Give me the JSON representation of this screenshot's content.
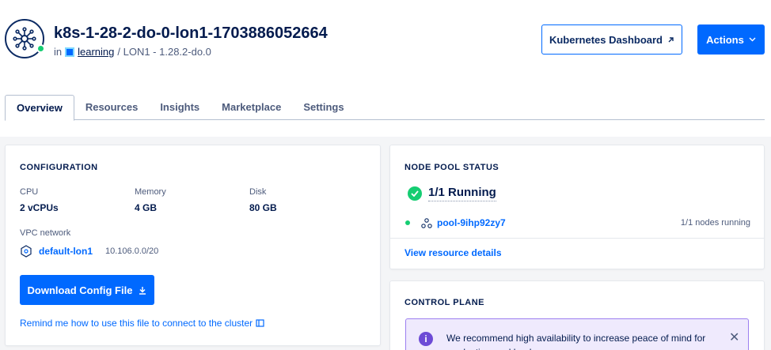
{
  "header": {
    "title": "k8s-1-28-2-do-0-lon1-1703886052664",
    "in_label": "in",
    "project_link": "learning",
    "location": "/ LON1 - 1.28.2-do.0",
    "dashboard_button": "Kubernetes Dashboard",
    "actions_button": "Actions"
  },
  "tabs": [
    {
      "label": "Overview",
      "active": true
    },
    {
      "label": "Resources",
      "active": false
    },
    {
      "label": "Insights",
      "active": false
    },
    {
      "label": "Marketplace",
      "active": false
    },
    {
      "label": "Settings",
      "active": false
    }
  ],
  "configuration": {
    "title": "CONFIGURATION",
    "cpu_label": "CPU",
    "cpu_value": "2 vCPUs",
    "memory_label": "Memory",
    "memory_value": "4 GB",
    "disk_label": "Disk",
    "disk_value": "80 GB",
    "vpc_label": "VPC network",
    "vpc_name": "default-lon1",
    "vpc_ip": "10.106.0.0/20",
    "download_button": "Download Config File",
    "remind_link": "Remind me how to use this file to connect to the cluster"
  },
  "node_pool": {
    "title": "NODE POOL STATUS",
    "running": "1/1 Running",
    "pool_name": "pool-9ihp92zy7",
    "nodes_running": "1/1 nodes running",
    "view_details": "View resource details"
  },
  "control_plane": {
    "title": "CONTROL PLANE",
    "alert_text": "We recommend high availability to increase peace of mind for production workloads."
  },
  "colors": {
    "accent": "#0069ff",
    "success": "#15cd72",
    "navy": "#031b4e",
    "alert_bg": "#efeafd",
    "alert_border": "#9c7ff0"
  },
  "icons": [
    "kubernetes-cluster-icon",
    "external-link-icon",
    "chevron-down-icon",
    "vpc-network-icon",
    "download-icon",
    "book-icon",
    "check-circle-icon",
    "node-pool-icon",
    "info-icon",
    "close-icon"
  ]
}
